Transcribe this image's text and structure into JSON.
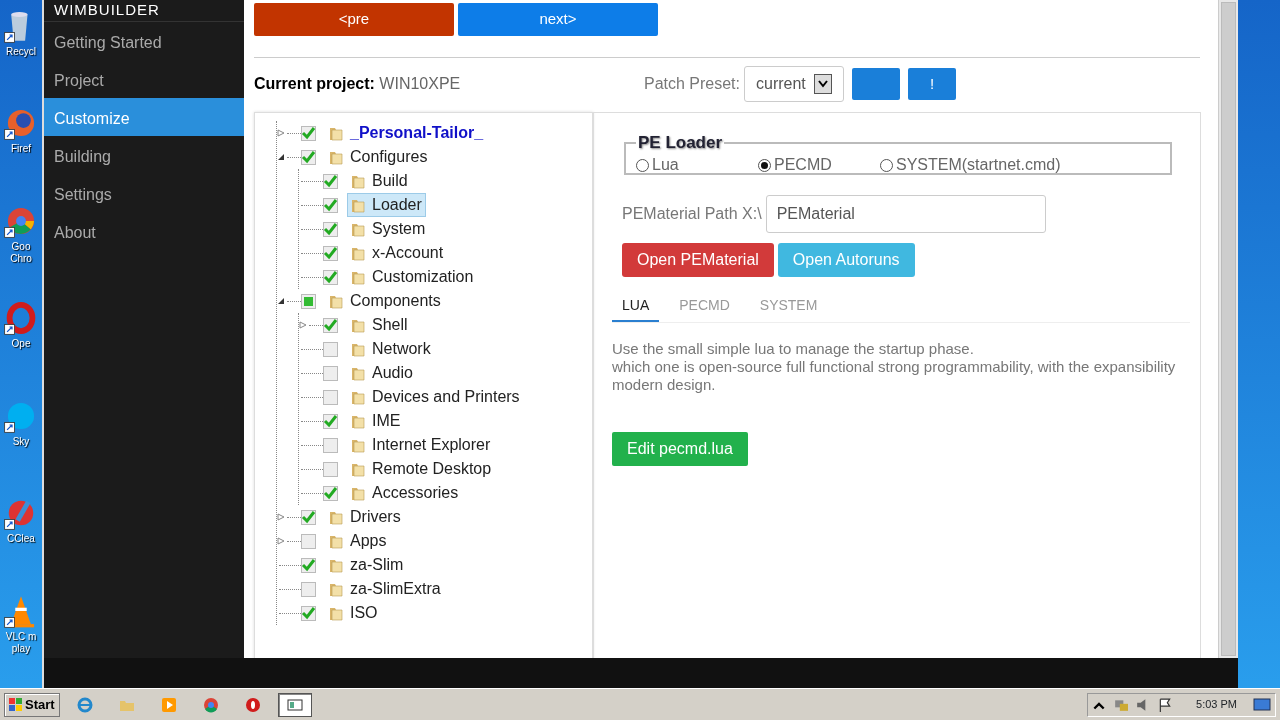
{
  "desktop_icons": [
    {
      "label": "Recycl",
      "kind": "bin"
    },
    {
      "label": "Firef",
      "kind": "fox"
    },
    {
      "label": "Goo Chro",
      "kind": "chrome"
    },
    {
      "label": "Ope",
      "kind": "opera"
    },
    {
      "label": "Sky",
      "kind": "skype"
    },
    {
      "label": "CClea",
      "kind": "ccleaner"
    },
    {
      "label": "VLC m play",
      "kind": "cone"
    }
  ],
  "app": {
    "brand": "WIMBUILDER",
    "sidebar": [
      {
        "label": "Getting Started",
        "selected": false
      },
      {
        "label": "Project",
        "selected": false
      },
      {
        "label": "Customize",
        "selected": true
      },
      {
        "label": "Building",
        "selected": false
      },
      {
        "label": "Settings",
        "selected": false
      },
      {
        "label": "About",
        "selected": false
      }
    ],
    "nav_buttons": [
      {
        "label": "<pre",
        "kind": "prev"
      },
      {
        "label": "next>",
        "kind": "next"
      }
    ],
    "project": {
      "label": "Current project:",
      "value": "WIN10XPE"
    },
    "patch_preset": {
      "label": "Patch Preset:",
      "value": "current",
      "buttons": [
        {
          "kind": "blank"
        },
        {
          "kind": "alert",
          "label": "!"
        }
      ]
    },
    "tree": [
      {
        "label": "_Personal-Tailor_",
        "checked": true,
        "selected": false,
        "emphasized": true,
        "expanded": false
      },
      {
        "label": "Configures",
        "checked": true,
        "selected": false,
        "emphasized": false,
        "expanded": true,
        "children": [
          {
            "label": "Build",
            "checked": true,
            "selected": false
          },
          {
            "label": "Loader",
            "checked": true,
            "selected": true
          },
          {
            "label": "System",
            "checked": true,
            "selected": false
          },
          {
            "label": "x-Account",
            "checked": true,
            "selected": false
          },
          {
            "label": "Customization",
            "checked": true,
            "selected": false
          }
        ]
      },
      {
        "label": "Components",
        "partial": true,
        "selected": false,
        "emphasized": false,
        "expanded": true,
        "children": [
          {
            "label": "Shell",
            "checked": true,
            "selected": false,
            "expanded": false
          },
          {
            "label": "Network",
            "checked": false,
            "selected": false
          },
          {
            "label": "Audio",
            "checked": false,
            "selected": false
          },
          {
            "label": "Devices and Printers",
            "checked": false,
            "selected": false
          },
          {
            "label": "IME",
            "checked": true,
            "selected": false
          },
          {
            "label": "Internet Explorer",
            "checked": false,
            "selected": false
          },
          {
            "label": "Remote Desktop",
            "checked": false,
            "selected": false
          },
          {
            "label": "Accessories",
            "checked": true,
            "selected": false
          }
        ]
      },
      {
        "label": "Drivers",
        "checked": true,
        "selected": false,
        "emphasized": false,
        "expanded": false
      },
      {
        "label": "Apps",
        "checked": false,
        "selected": false,
        "emphasized": false,
        "expanded": false
      },
      {
        "label": "za-Slim",
        "checked": true,
        "selected": false,
        "emphasized": false
      },
      {
        "label": "za-SlimExtra",
        "checked": false,
        "selected": false,
        "emphasized": false
      },
      {
        "label": "ISO",
        "checked": true,
        "selected": false,
        "emphasized": false
      }
    ],
    "pe_loader": {
      "title": "PE Loader",
      "options": [
        {
          "label": "Lua",
          "selected": false
        },
        {
          "label": "PECMD",
          "selected": true
        },
        {
          "label": "SYSTEM(startnet.cmd)",
          "selected": false
        }
      ]
    },
    "path": {
      "label": "PEMaterial Path X:\\",
      "value": "PEMaterial"
    },
    "action_buttons": [
      {
        "label": "Open PEMaterial",
        "kind": "danger"
      },
      {
        "label": "Open Autoruns",
        "kind": "info"
      }
    ],
    "tabs": [
      {
        "label": "LUA",
        "selected": true
      },
      {
        "label": "PECMD",
        "selected": false
      },
      {
        "label": "SYSTEM",
        "selected": false
      }
    ],
    "description": [
      "Use the small simple lua to manage the startup phase.",
      "which one is open-source full functional strong programmability, with the expansibility modern design."
    ],
    "edit_button": {
      "label": "Edit pecmd.lua"
    }
  },
  "taskbar": {
    "start": "Start",
    "apps": [
      {
        "kind": "ie",
        "selected": false
      },
      {
        "kind": "folder",
        "selected": false
      },
      {
        "kind": "media",
        "selected": false
      },
      {
        "kind": "chrome",
        "selected": false
      },
      {
        "kind": "opera",
        "selected": false
      },
      {
        "kind": "window",
        "selected": true
      }
    ],
    "clock": "5:03 PM"
  }
}
